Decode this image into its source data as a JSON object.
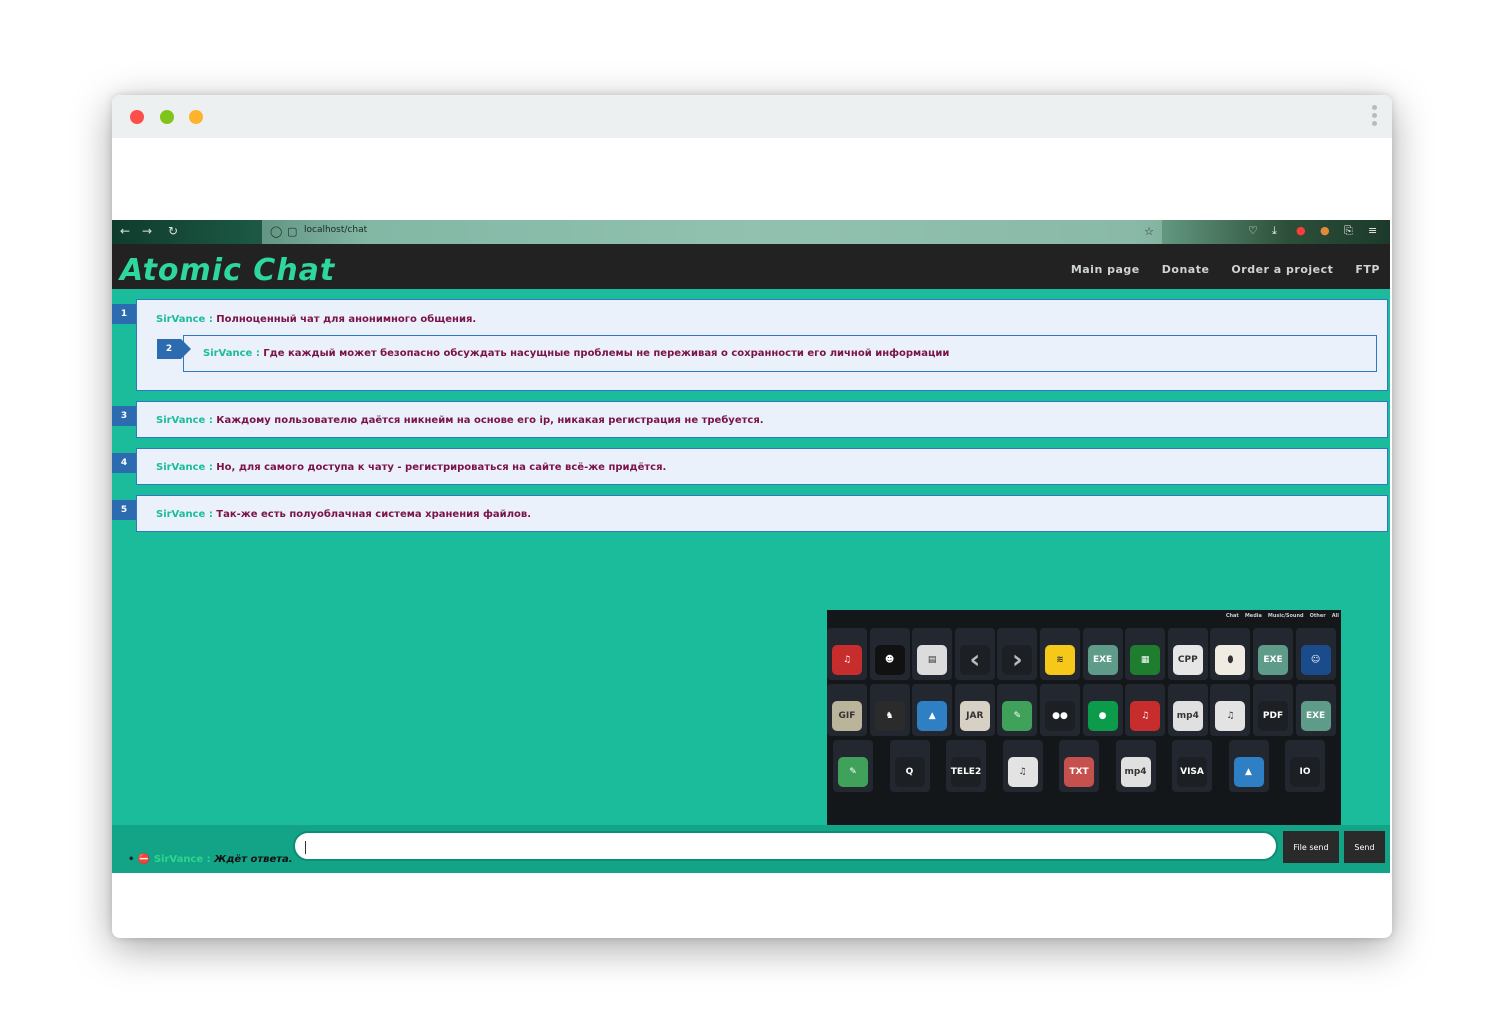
{
  "browser": {
    "url": "localhost/chat"
  },
  "site": {
    "logo": "Atomic Chat",
    "nav": [
      "Main page",
      "Donate",
      "Order a project",
      "FTP"
    ]
  },
  "messages": [
    {
      "num": "1",
      "nick": "SirVance :",
      "text": "Полноценный чат для анонимного общения.",
      "reply": {
        "num": "2",
        "nick": "SirVance :",
        "text": "Где каждый может безопасно обсуждать насущные проблемы не переживая о сохранности его личной информации"
      }
    },
    {
      "num": "3",
      "nick": "SirVance :",
      "text": "Каждому пользователю даётся никнейм на основе его ip, никакая регистрация не требуется."
    },
    {
      "num": "4",
      "nick": "SirVance :",
      "text": "Но, для самого доступа к чату - регистрироваться на сайте всё-же придётся."
    },
    {
      "num": "5",
      "nick": "SirVance :",
      "text": "Так-же есть полуоблачная система хранения файлов."
    }
  ],
  "file_panel": {
    "tabs": [
      "Chat",
      "Media",
      "Music/Sound",
      "Other",
      "All"
    ],
    "row1": [
      "music",
      "dark",
      "archive",
      "chevron-left",
      "chevron-right",
      "beeline",
      "EXE",
      "ram",
      "CPP",
      "egg",
      "EXE",
      "face"
    ],
    "row2": [
      "GIF",
      "figure",
      "image",
      "JAR",
      "cpp-book",
      "mastercard",
      "circle-green",
      "music",
      "mp4",
      "ogg",
      "pdf",
      "EXE"
    ],
    "row3": [
      "book",
      "Q",
      "TELE2",
      "ogg",
      "TXT",
      "mp4",
      "VISA",
      "image",
      "IO"
    ]
  },
  "status": {
    "nick": "SirVance :",
    "text": "Ждёт ответа."
  },
  "compose": {
    "file_send": "File send",
    "send": "Send"
  }
}
